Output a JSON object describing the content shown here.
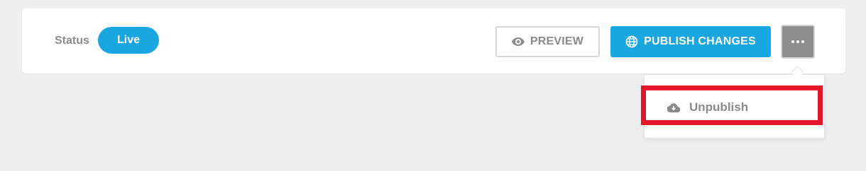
{
  "status": {
    "label": "Status",
    "value": "Live"
  },
  "toolbar": {
    "preview_label": "PREVIEW",
    "publish_label": "PUBLISH CHANGES",
    "more_icon": "more-horizontal-icon"
  },
  "dropdown": {
    "items": [
      {
        "label": "Unpublish",
        "icon": "cloud-download-icon"
      }
    ]
  },
  "colors": {
    "accent": "#1aa7e1",
    "highlight": "#e3162a",
    "muted_text": "#8a8a8a",
    "more_button": "#8d8d8d"
  }
}
